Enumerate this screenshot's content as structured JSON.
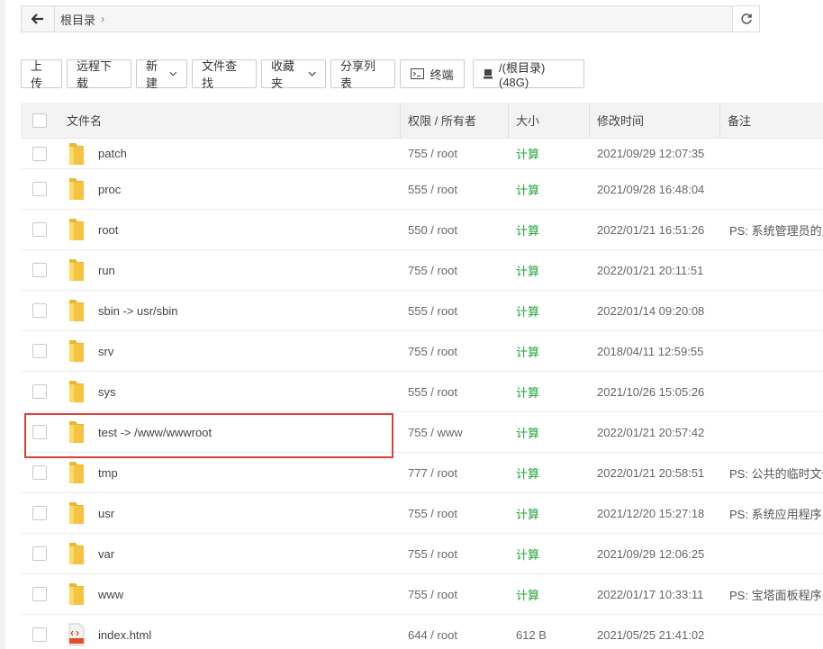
{
  "pathbar": {
    "crumbs": [
      {
        "label": "根目录"
      }
    ]
  },
  "toolbar": {
    "upload": "上传",
    "remote_download": "远程下载",
    "new": "新建",
    "file_search": "文件查找",
    "favorites": "收藏夹",
    "share_list": "分享列表",
    "terminal": "终端",
    "disk": "/(根目录) (48G)"
  },
  "table": {
    "headers": {
      "name": "文件名",
      "perm": "权限 / 所有者",
      "size": "大小",
      "mtime": "修改时间",
      "note": "备注"
    },
    "rows": [
      {
        "name": "patch",
        "perm": "755 / root",
        "size": "计算",
        "mtime": "2021/09/29 12:07:35",
        "note": "",
        "type": "folder"
      },
      {
        "name": "proc",
        "perm": "555 / root",
        "size": "计算",
        "mtime": "2021/09/28 16:48:04",
        "note": "",
        "type": "folder"
      },
      {
        "name": "root",
        "perm": "550 / root",
        "size": "计算",
        "mtime": "2022/01/21 16:51:26",
        "note": "PS: 系统管理员的主",
        "type": "folder"
      },
      {
        "name": "run",
        "perm": "755 / root",
        "size": "计算",
        "mtime": "2022/01/21 20:11:51",
        "note": "",
        "type": "folder"
      },
      {
        "name": "sbin -> usr/sbin",
        "perm": "555 / root",
        "size": "计算",
        "mtime": "2022/01/14 09:20:08",
        "note": "",
        "type": "folder"
      },
      {
        "name": "srv",
        "perm": "755 / root",
        "size": "计算",
        "mtime": "2018/04/11 12:59:55",
        "note": "",
        "type": "folder"
      },
      {
        "name": "sys",
        "perm": "555 / root",
        "size": "计算",
        "mtime": "2021/10/26 15:05:26",
        "note": "",
        "type": "folder"
      },
      {
        "name": "test -> /www/wwwroot",
        "perm": "755 / www",
        "size": "计算",
        "mtime": "2022/01/21 20:57:42",
        "note": "",
        "type": "folder"
      },
      {
        "name": "tmp",
        "perm": "777 / root",
        "size": "计算",
        "mtime": "2022/01/21 20:58:51",
        "note": "PS: 公共的临时文件",
        "type": "folder"
      },
      {
        "name": "usr",
        "perm": "755 / root",
        "size": "计算",
        "mtime": "2021/12/20 15:27:18",
        "note": "PS: 系统应用程序目",
        "type": "folder"
      },
      {
        "name": "var",
        "perm": "755 / root",
        "size": "计算",
        "mtime": "2021/09/29 12:06:25",
        "note": "",
        "type": "folder"
      },
      {
        "name": "www",
        "perm": "755 / root",
        "size": "计算",
        "mtime": "2022/01/17 10:33:11",
        "note": "PS: 宝塔面板程序目",
        "type": "folder"
      },
      {
        "name": "index.html",
        "perm": "644 / root",
        "size": "612 B",
        "mtime": "2021/05/25 21:41:02",
        "note": "",
        "type": "html"
      }
    ]
  },
  "colors": {
    "accent_green": "#20a53a",
    "highlight_red": "#d9413a",
    "folder_yellow": "#f5c342"
  },
  "icons": {
    "html_badge": "HTML"
  }
}
